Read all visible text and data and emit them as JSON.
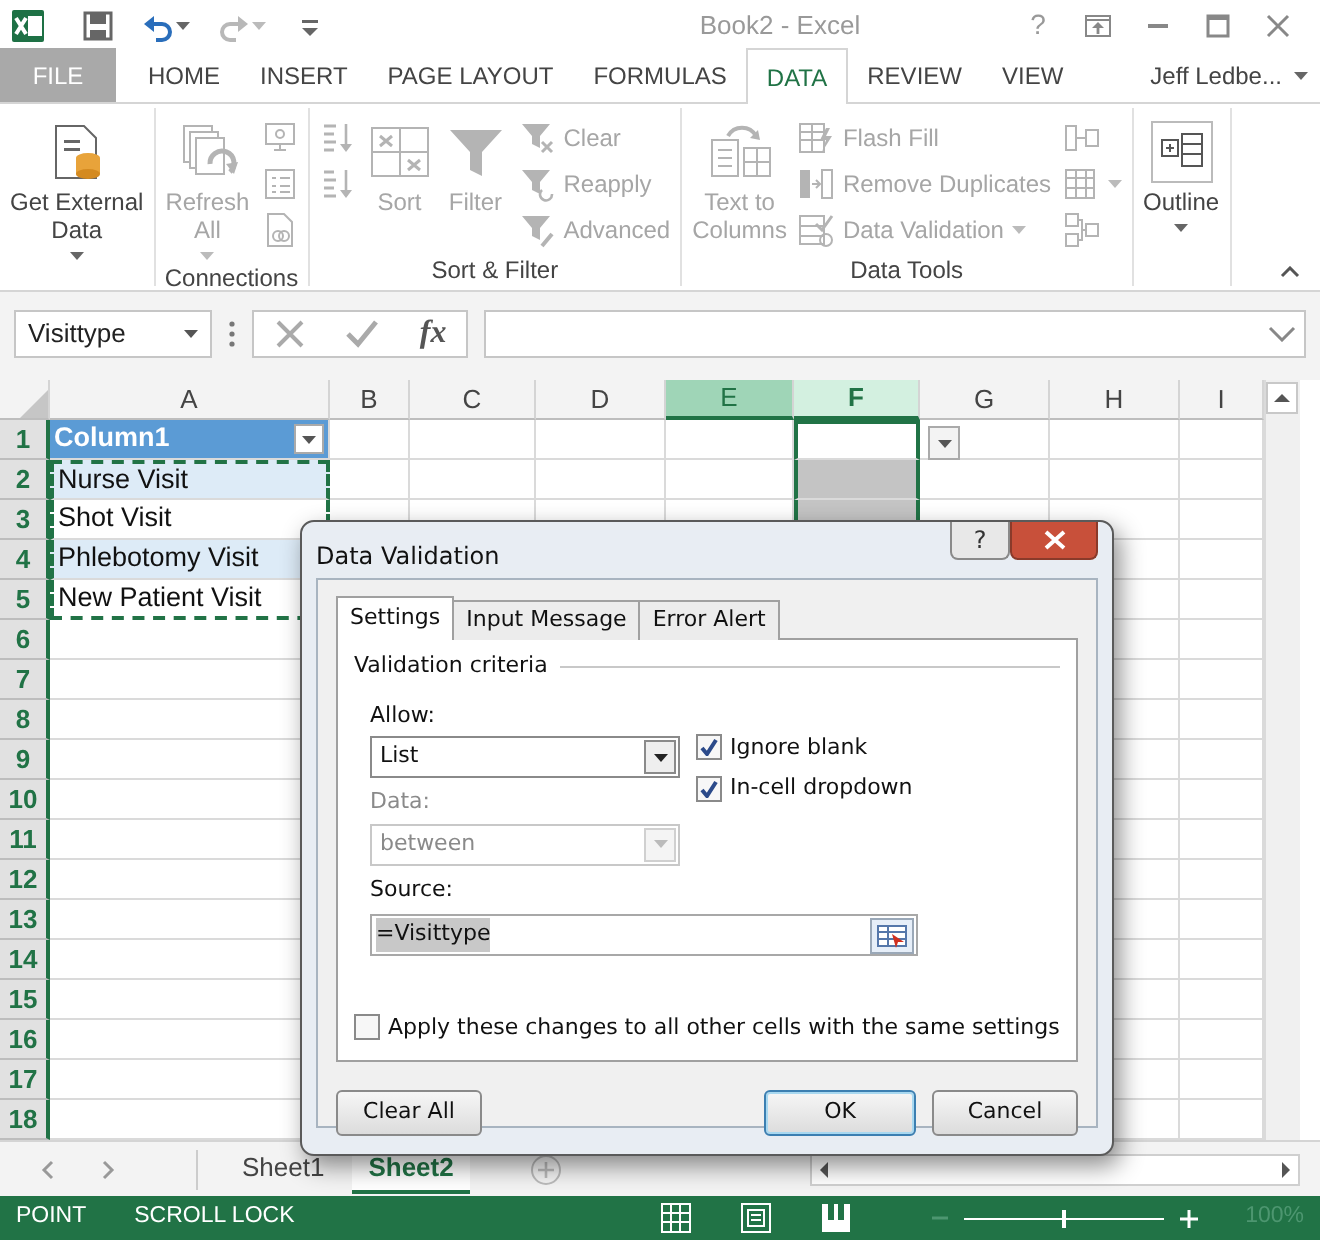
{
  "title_bar": {
    "title": "Book2 - Excel",
    "help": "?",
    "quick_access": [
      {
        "kind": "save",
        "disabled": false,
        "dropdown": false
      },
      {
        "kind": "undo",
        "disabled": false,
        "dropdown": true
      },
      {
        "kind": "redo",
        "disabled": true,
        "dropdown": true
      },
      {
        "kind": "customize",
        "disabled": false,
        "dropdown": false
      }
    ]
  },
  "ribbon_tabs": [
    {
      "label": "FILE",
      "selected": false,
      "kind": "file"
    },
    {
      "label": "HOME",
      "selected": false,
      "kind": "tab"
    },
    {
      "label": "INSERT",
      "selected": false,
      "kind": "tab"
    },
    {
      "label": "PAGE LAYOUT",
      "selected": false,
      "kind": "tab"
    },
    {
      "label": "FORMULAS",
      "selected": false,
      "kind": "tab"
    },
    {
      "label": "DATA",
      "selected": true,
      "kind": "tab"
    },
    {
      "label": "REVIEW",
      "selected": false,
      "kind": "tab"
    },
    {
      "label": "VIEW",
      "selected": false,
      "kind": "tab"
    }
  ],
  "account": {
    "name": "Jeff Ledbe..."
  },
  "ribbon_groups": [
    {
      "commands": [
        {
          "label": "Get External\nData",
          "kind": "external",
          "disabled": false,
          "dropdown": true
        }
      ]
    },
    {
      "label": "Connections",
      "commands": [
        {
          "label": "Refresh\nAll",
          "kind": "refresh",
          "disabled": true,
          "dropdown": true
        },
        {
          "kind": "connections",
          "disabled": true
        },
        {
          "kind": "properties",
          "disabled": true
        },
        {
          "kind": "links",
          "disabled": true
        }
      ]
    },
    {
      "label": "Sort & Filter",
      "commands": [
        {
          "kind": "sort_asc",
          "disabled": true
        },
        {
          "kind": "sort_desc",
          "disabled": true
        },
        {
          "label": "Sort",
          "kind": "sort",
          "disabled": true
        },
        {
          "label": "Filter",
          "kind": "filter",
          "disabled": true
        },
        {
          "label": "Clear",
          "kind": "clear",
          "disabled": true
        },
        {
          "label": "Reapply",
          "kind": "reapply",
          "disabled": true
        },
        {
          "label": "Advanced",
          "kind": "advanced",
          "disabled": true
        }
      ]
    },
    {
      "label": "Data Tools",
      "commands": [
        {
          "label": "Text to\nColumns",
          "kind": "text_columns",
          "disabled": true
        },
        {
          "label": "Flash Fill",
          "kind": "flash",
          "disabled": true
        },
        {
          "label": "Remove Duplicates",
          "kind": "duplicates",
          "disabled": true
        },
        {
          "label": "Data Validation",
          "kind": "validation",
          "disabled": true,
          "dropdown": true
        },
        {
          "kind": "consolidate",
          "disabled": true
        },
        {
          "kind": "whatif",
          "disabled": true,
          "dropdown": true
        },
        {
          "kind": "relationships",
          "disabled": true
        }
      ]
    },
    {
      "commands": [
        {
          "label": "Outline",
          "kind": "outline",
          "disabled": false,
          "dropdown": true
        }
      ]
    }
  ],
  "formula_bar": {
    "name_box": "Visittype",
    "function_label": "fx"
  },
  "columns": [
    {
      "label": "A",
      "selected": false,
      "hovered": false
    },
    {
      "label": "B",
      "selected": false,
      "hovered": false
    },
    {
      "label": "C",
      "selected": false,
      "hovered": false
    },
    {
      "label": "D",
      "selected": false,
      "hovered": false
    },
    {
      "label": "E",
      "selected": false,
      "hovered": true
    },
    {
      "label": "F",
      "selected": true,
      "hovered": false
    },
    {
      "label": "G",
      "selected": false,
      "hovered": false
    },
    {
      "label": "H",
      "selected": false,
      "hovered": false
    },
    {
      "label": "I",
      "selected": false,
      "hovered": false
    }
  ],
  "rows": [
    {
      "label": "1",
      "a": {
        "text": "Column1",
        "kind": "table_header",
        "marquee": false
      },
      "f_active": true,
      "f_selected": true,
      "f_dropdown": true
    },
    {
      "label": "2",
      "a": {
        "text": "Nurse Visit",
        "kind": "band",
        "marquee": true
      },
      "f_active": false,
      "f_selected": true
    },
    {
      "label": "3",
      "a": {
        "text": "Shot Visit",
        "kind": "plain",
        "marquee": true
      },
      "f_active": false,
      "f_selected": true
    },
    {
      "label": "4",
      "a": {
        "text": "Phlebotomy Visit",
        "kind": "band",
        "marquee": true
      }
    },
    {
      "label": "5",
      "a": {
        "text": "New Patient Visit",
        "kind": "plain",
        "marquee": true
      }
    },
    {
      "label": "6"
    },
    {
      "label": "7"
    },
    {
      "label": "8"
    },
    {
      "label": "9"
    },
    {
      "label": "10"
    },
    {
      "label": "11"
    },
    {
      "label": "12"
    },
    {
      "label": "13"
    },
    {
      "label": "14"
    },
    {
      "label": "15"
    },
    {
      "label": "16"
    },
    {
      "label": "17"
    },
    {
      "label": "18"
    }
  ],
  "sheet_tabs": [
    {
      "label": "Sheet1",
      "selected": false
    },
    {
      "label": "Sheet2",
      "selected": true
    }
  ],
  "status_bar": {
    "modes": [
      "POINT",
      "SCROLL LOCK"
    ],
    "views": [
      {
        "kind": "normal"
      },
      {
        "kind": "page_layout"
      },
      {
        "kind": "page_break"
      }
    ],
    "zoom": {
      "label": "100%",
      "level": 0.5
    }
  },
  "dialog": {
    "title": "Data Validation",
    "help": "?",
    "tabs": [
      {
        "label": "Settings",
        "selected": true
      },
      {
        "label": "Input Message",
        "selected": false
      },
      {
        "label": "Error Alert",
        "selected": false
      }
    ],
    "section": "Validation criteria",
    "allow": {
      "label": "Allow:",
      "value": "List",
      "disabled": false
    },
    "options": [
      {
        "label": "Ignore blank",
        "checked": true
      },
      {
        "label": "In-cell dropdown",
        "checked": true
      }
    ],
    "data": {
      "label": "Data:",
      "value": "between",
      "disabled": true
    },
    "source": {
      "label": "Source:",
      "value": "=Visittype",
      "value_selected": true
    },
    "apply_all": {
      "label": "Apply these changes to all other cells with the same settings",
      "checked": false
    },
    "buttons": [
      {
        "label": "Clear All",
        "kind": "left"
      },
      {
        "label": "OK",
        "kind": "default"
      },
      {
        "label": "Cancel",
        "kind": "normal"
      }
    ]
  }
}
